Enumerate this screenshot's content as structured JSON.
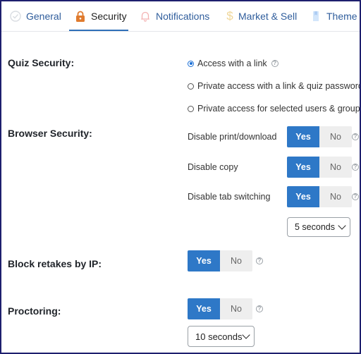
{
  "tabs": [
    {
      "label": "General",
      "icon": "check-circle-icon"
    },
    {
      "label": "Security",
      "icon": "lock-icon"
    },
    {
      "label": "Notifications",
      "icon": "bell-icon"
    },
    {
      "label": "Market & Sell",
      "icon": "dollar-icon"
    },
    {
      "label": "Theme",
      "icon": "theme-icon"
    }
  ],
  "active_tab": "Security",
  "colors": {
    "accent": "#2e78c7",
    "tab_text": "#2f5d9c",
    "frame": "#1e1f6e"
  },
  "quiz_security": {
    "label": "Quiz Security:",
    "options": [
      {
        "label": "Access with a link",
        "selected": true
      },
      {
        "label": "Private access with a link & quiz password",
        "selected": false
      },
      {
        "label": "Private access for selected users & groups",
        "selected": false
      }
    ]
  },
  "browser_security": {
    "label": "Browser Security:",
    "settings": [
      {
        "label": "Disable print/download",
        "yes": "Yes",
        "no": "No",
        "value": "Yes"
      },
      {
        "label": "Disable copy",
        "yes": "Yes",
        "no": "No",
        "value": "Yes"
      },
      {
        "label": "Disable tab switching",
        "yes": "Yes",
        "no": "No",
        "value": "Yes"
      }
    ],
    "tab_switch_delay": "5 seconds"
  },
  "block_retakes": {
    "label": "Block retakes by IP:",
    "yes": "Yes",
    "no": "No",
    "value": "Yes"
  },
  "proctoring": {
    "label": "Proctoring:",
    "yes": "Yes",
    "no": "No",
    "value": "Yes",
    "interval": "10 seconds"
  }
}
